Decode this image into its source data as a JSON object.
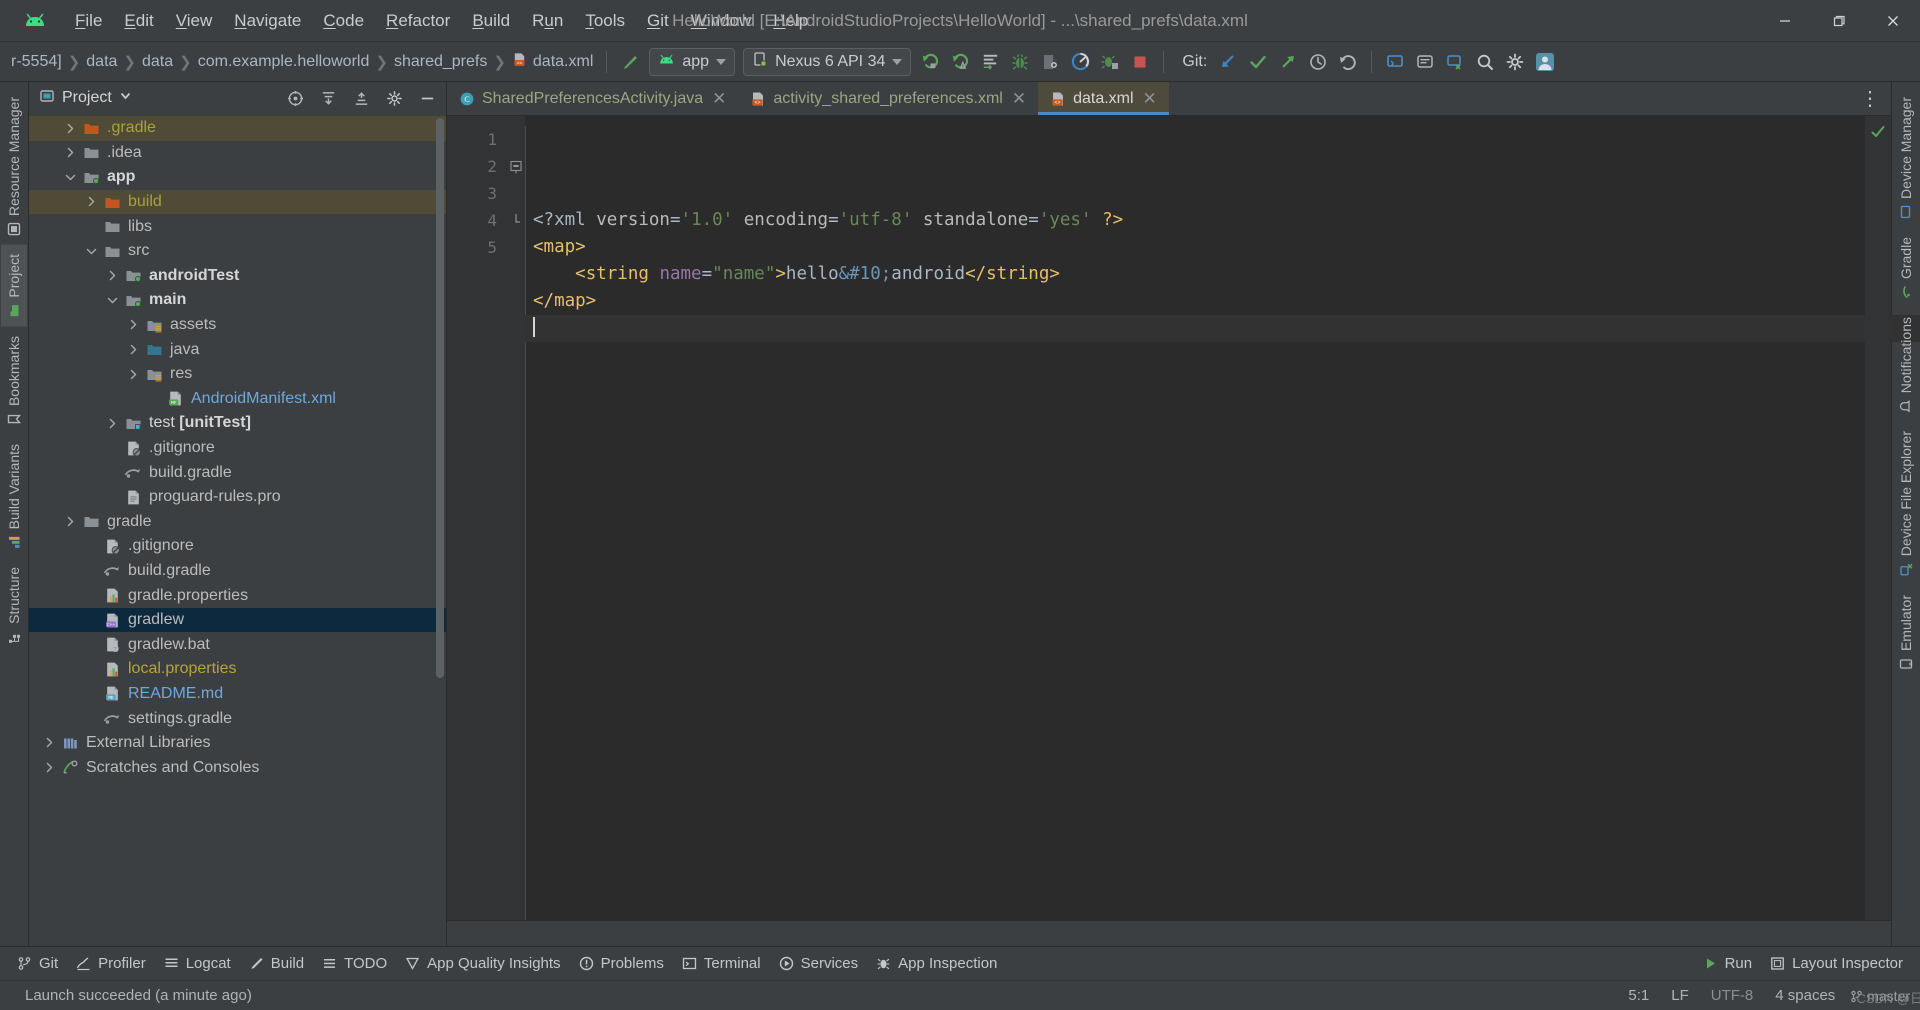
{
  "window": {
    "title": "HelloWorld [E:\\AndroidStudioProjects\\HelloWorld] - ...\\shared_prefs\\data.xml",
    "minimize_label": "Minimize",
    "maximize_label": "Restore",
    "close_label": "Close"
  },
  "menubar": {
    "items": [
      {
        "label": "File",
        "accel": "F"
      },
      {
        "label": "Edit",
        "accel": "E"
      },
      {
        "label": "View",
        "accel": "V"
      },
      {
        "label": "Navigate",
        "accel": "N"
      },
      {
        "label": "Code",
        "accel": "C"
      },
      {
        "label": "Refactor",
        "accel": "R"
      },
      {
        "label": "Build",
        "accel": "B"
      },
      {
        "label": "Run",
        "accel": "u"
      },
      {
        "label": "Tools",
        "accel": "T"
      },
      {
        "label": "Git",
        "accel": "G"
      },
      {
        "label": "Window",
        "accel": "W"
      },
      {
        "label": "Help",
        "accel": "H"
      }
    ]
  },
  "navbar": {
    "breadcrumbs": [
      "r-5554]",
      "data",
      "data",
      "com.example.helloworld",
      "shared_prefs",
      "data.xml"
    ],
    "run_config": "app",
    "device": "Nexus 6 API 34",
    "git_label": "Git:",
    "icons": [
      "make-project-icon",
      "run-icon",
      "debug-icon",
      "more-run-icon",
      "bug-icon",
      "layout-inspector-icon",
      "profiler-icon",
      "attach-debugger-icon",
      "stop-icon",
      "git-update-icon",
      "git-commit-icon",
      "git-push-icon",
      "history-icon",
      "rollback-icon",
      "device-manager-icon",
      "notifications-icon",
      "device-explorer-icon",
      "search-icon",
      "settings-icon",
      "account-icon"
    ]
  },
  "left_strip": {
    "items": [
      {
        "label": "Resource Manager",
        "icon": "resource-manager-icon",
        "active": false
      },
      {
        "label": "Project",
        "icon": "project-icon",
        "active": true
      },
      {
        "label": "Bookmarks",
        "icon": "bookmarks-icon",
        "active": false
      },
      {
        "label": "Build Variants",
        "icon": "build-variants-icon",
        "active": false
      },
      {
        "label": "Structure",
        "icon": "structure-icon",
        "active": false
      }
    ]
  },
  "right_strip": {
    "items": [
      {
        "label": "Device Manager",
        "icon": "device-manager-icon"
      },
      {
        "label": "Gradle",
        "icon": "gradle-icon"
      },
      {
        "label": "Notifications",
        "icon": "notifications-icon"
      },
      {
        "label": "Device File Explorer",
        "icon": "device-file-explorer-icon"
      },
      {
        "label": "Emulator",
        "icon": "emulator-icon"
      }
    ]
  },
  "project_panel": {
    "title": "Project",
    "dropdown_icon": "chevron-down-icon",
    "buttons": [
      "select-opened-file-icon",
      "expand-all-icon",
      "collapse-all-icon",
      "settings-icon",
      "hide-icon"
    ],
    "tree": [
      {
        "label": ".gradle",
        "indent": 1,
        "arrow": "right",
        "icon": "folder-orange",
        "color": "olive",
        "state": "highlight"
      },
      {
        "label": ".idea",
        "indent": 1,
        "arrow": "right",
        "icon": "folder",
        "color": "",
        "state": ""
      },
      {
        "label": "app",
        "indent": 1,
        "arrow": "down",
        "icon": "folder-module",
        "color": "bold",
        "state": ""
      },
      {
        "label": "build",
        "indent": 2,
        "arrow": "right",
        "icon": "folder-orange",
        "color": "olive",
        "state": "highlight"
      },
      {
        "label": "libs",
        "indent": 2,
        "arrow": "none",
        "icon": "folder",
        "color": "",
        "state": ""
      },
      {
        "label": "src",
        "indent": 2,
        "arrow": "down",
        "icon": "folder",
        "color": "",
        "state": ""
      },
      {
        "label": "androidTest",
        "indent": 3,
        "arrow": "right",
        "icon": "folder-module",
        "color": "bold",
        "state": ""
      },
      {
        "label": "main",
        "indent": 3,
        "arrow": "down",
        "icon": "folder-module",
        "color": "bold",
        "state": ""
      },
      {
        "label": "assets",
        "indent": 4,
        "arrow": "right",
        "icon": "folder-res",
        "color": "",
        "state": ""
      },
      {
        "label": "java",
        "indent": 4,
        "arrow": "right",
        "icon": "folder-source",
        "color": "",
        "state": ""
      },
      {
        "label": "res",
        "indent": 4,
        "arrow": "right",
        "icon": "folder-res",
        "color": "",
        "state": ""
      },
      {
        "label": "AndroidManifest.xml",
        "indent": 5,
        "arrow": "none",
        "icon": "manifest-file",
        "color": "blue",
        "state": ""
      },
      {
        "label": "test [unitTest]",
        "indent": 3,
        "arrow": "right",
        "icon": "folder-test",
        "color": "bold",
        "state": ""
      },
      {
        "label": ".gitignore",
        "indent": 3,
        "arrow": "none",
        "icon": "gitignore-file",
        "color": "",
        "state": ""
      },
      {
        "label": "build.gradle",
        "indent": 3,
        "arrow": "none",
        "icon": "gradle-file",
        "color": "",
        "state": ""
      },
      {
        "label": "proguard-rules.pro",
        "indent": 3,
        "arrow": "none",
        "icon": "text-file",
        "color": "",
        "state": ""
      },
      {
        "label": "gradle",
        "indent": 1,
        "arrow": "right",
        "icon": "folder",
        "color": "",
        "state": ""
      },
      {
        "label": ".gitignore",
        "indent": 2,
        "arrow": "none",
        "icon": "gitignore-file",
        "color": "",
        "state": ""
      },
      {
        "label": "build.gradle",
        "indent": 2,
        "arrow": "none",
        "icon": "gradle-file",
        "color": "",
        "state": ""
      },
      {
        "label": "gradle.properties",
        "indent": 2,
        "arrow": "none",
        "icon": "properties-file",
        "color": "",
        "state": ""
      },
      {
        "label": "gradlew",
        "indent": 2,
        "arrow": "none",
        "icon": "cpp-file",
        "color": "",
        "state": "selected"
      },
      {
        "label": "gradlew.bat",
        "indent": 2,
        "arrow": "none",
        "icon": "bat-file",
        "color": "",
        "state": ""
      },
      {
        "label": "local.properties",
        "indent": 2,
        "arrow": "none",
        "icon": "properties-file",
        "color": "yellow",
        "state": ""
      },
      {
        "label": "README.md",
        "indent": 2,
        "arrow": "none",
        "icon": "markdown-file",
        "color": "blue",
        "state": ""
      },
      {
        "label": "settings.gradle",
        "indent": 2,
        "arrow": "none",
        "icon": "gradle-file",
        "color": "",
        "state": ""
      },
      {
        "label": "External Libraries",
        "indent": 0,
        "arrow": "right",
        "icon": "libraries-icon",
        "color": "",
        "state": ""
      },
      {
        "label": "Scratches and Consoles",
        "indent": 0,
        "arrow": "right",
        "icon": "scratches-icon",
        "color": "",
        "state": ""
      }
    ]
  },
  "editor": {
    "tabs": [
      {
        "label": "SharedPreferencesActivity.java",
        "icon": "java-class-icon",
        "active": false
      },
      {
        "label": "activity_shared_preferences.xml",
        "icon": "xml-file-icon",
        "active": false
      },
      {
        "label": "data.xml",
        "icon": "xml-file-icon",
        "active": true
      }
    ],
    "kebab_label": "⋮",
    "line_numbers": [
      "1",
      "2",
      "3",
      "4",
      "5"
    ],
    "lines": [
      {
        "n": 1,
        "fold": "",
        "segments": [
          {
            "t": "<?xml ",
            "c": "pi"
          },
          {
            "t": "version",
            "c": "name"
          },
          {
            "t": "=",
            "c": "txt"
          },
          {
            "t": "'1.0'",
            "c": "str"
          },
          {
            "t": " ",
            "c": "txt"
          },
          {
            "t": "encoding",
            "c": "name"
          },
          {
            "t": "=",
            "c": "txt"
          },
          {
            "t": "'utf-8'",
            "c": "str"
          },
          {
            "t": " ",
            "c": "txt"
          },
          {
            "t": "standalone",
            "c": "name"
          },
          {
            "t": "=",
            "c": "txt"
          },
          {
            "t": "'yes'",
            "c": "str"
          },
          {
            "t": " ",
            "c": "txt"
          },
          {
            "t": "?>",
            "c": "tag"
          }
        ]
      },
      {
        "n": 2,
        "fold": "minus",
        "segments": [
          {
            "t": "<map>",
            "c": "tag"
          }
        ]
      },
      {
        "n": 3,
        "fold": "",
        "segments": [
          {
            "t": "    ",
            "c": "txt"
          },
          {
            "t": "<string ",
            "c": "tag"
          },
          {
            "t": "name",
            "c": "attr"
          },
          {
            "t": "=",
            "c": "txt"
          },
          {
            "t": "\"name\"",
            "c": "str"
          },
          {
            "t": ">",
            "c": "tag"
          },
          {
            "t": "hello",
            "c": "txt"
          },
          {
            "t": "&#10;",
            "c": "ent"
          },
          {
            "t": "android",
            "c": "txt"
          },
          {
            "t": "</string>",
            "c": "tag"
          }
        ]
      },
      {
        "n": 4,
        "fold": "end",
        "segments": [
          {
            "t": "</map>",
            "c": "tag"
          }
        ]
      },
      {
        "n": 5,
        "fold": "",
        "segments": [],
        "caret": true,
        "current": true
      }
    ],
    "inspection_status": "ok-check-icon"
  },
  "toolwindow_bar": {
    "left": [
      {
        "label": "Git",
        "icon": "git-icon"
      },
      {
        "label": "Profiler",
        "icon": "profiler-icon"
      },
      {
        "label": "Logcat",
        "icon": "logcat-icon"
      },
      {
        "label": "Build",
        "icon": "build-icon"
      },
      {
        "label": "TODO",
        "icon": "todo-icon"
      },
      {
        "label": "App Quality Insights",
        "icon": "app-quality-insights-icon"
      },
      {
        "label": "Problems",
        "icon": "problems-icon"
      },
      {
        "label": "Terminal",
        "icon": "terminal-icon"
      },
      {
        "label": "Services",
        "icon": "services-icon"
      },
      {
        "label": "App Inspection",
        "icon": "app-inspection-icon"
      }
    ],
    "right": [
      {
        "label": "Run",
        "icon": "run-icon"
      },
      {
        "label": "Layout Inspector",
        "icon": "layout-inspector-icon"
      }
    ]
  },
  "statusbar": {
    "message": "Launch succeeded (a minute ago)",
    "caret_position": "5:1",
    "line_separator": "LF",
    "encoding": "UTF-8",
    "indent": "4 spaces",
    "branch": "master",
    "watermark": "CSDN @日程月痕"
  },
  "colors": {
    "accent_blue": "#4a88c7",
    "android_green": "#3ddc84",
    "selection_blue": "#0d293e",
    "highlight_olive": "#4f4b36",
    "editor_bg": "#2b2b2b",
    "panel_bg": "#3c3f41",
    "tag_orange": "#e8bf6a",
    "string_green": "#6a8759",
    "entity_blue": "#6897bb",
    "attr_purple": "#9876aa",
    "stop_red": "#c75450"
  }
}
